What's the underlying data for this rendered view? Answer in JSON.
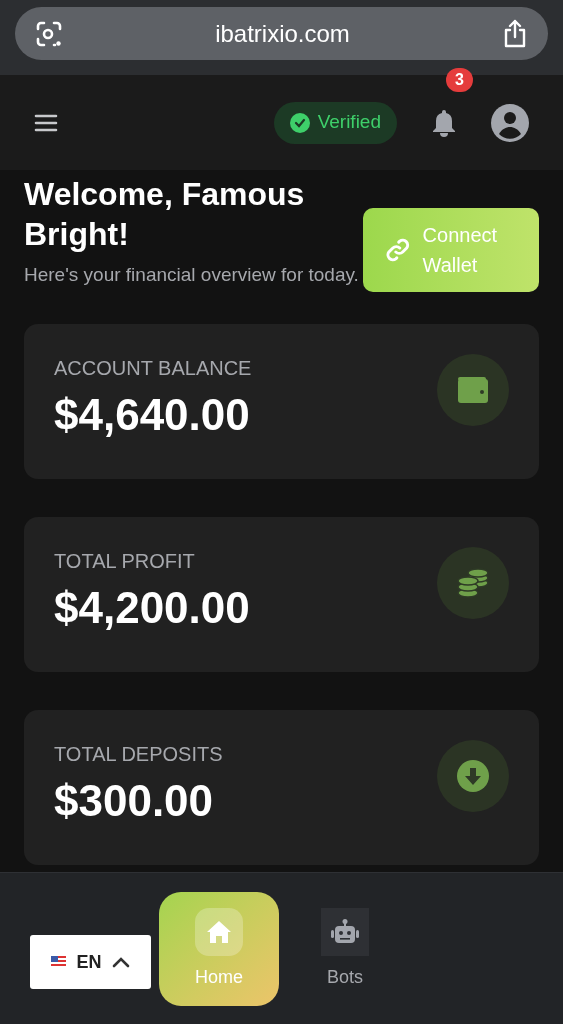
{
  "browser": {
    "url": "ibatrixio.com"
  },
  "header": {
    "verified": {
      "label": "Verified",
      "verified": true
    },
    "notifications": {
      "count": "3"
    }
  },
  "welcome": {
    "title": "Welcome, Famous Bright!",
    "subtitle": "Here's your financial overview for today.",
    "connect_button": "Connect Wallet"
  },
  "cards": [
    {
      "label": "ACCOUNT BALANCE",
      "value": "$4,640.00",
      "kind": "wallet"
    },
    {
      "label": "TOTAL PROFIT",
      "value": "$4,200.00",
      "kind": "coins"
    },
    {
      "label": "TOTAL DEPOSITS",
      "value": "$300.00",
      "kind": "deposit"
    }
  ],
  "language": {
    "code": "EN"
  },
  "nav": [
    {
      "label": "Home",
      "kind": "home",
      "selected": true
    },
    {
      "label": "Bots",
      "kind": "bot",
      "selected": false
    }
  ]
}
